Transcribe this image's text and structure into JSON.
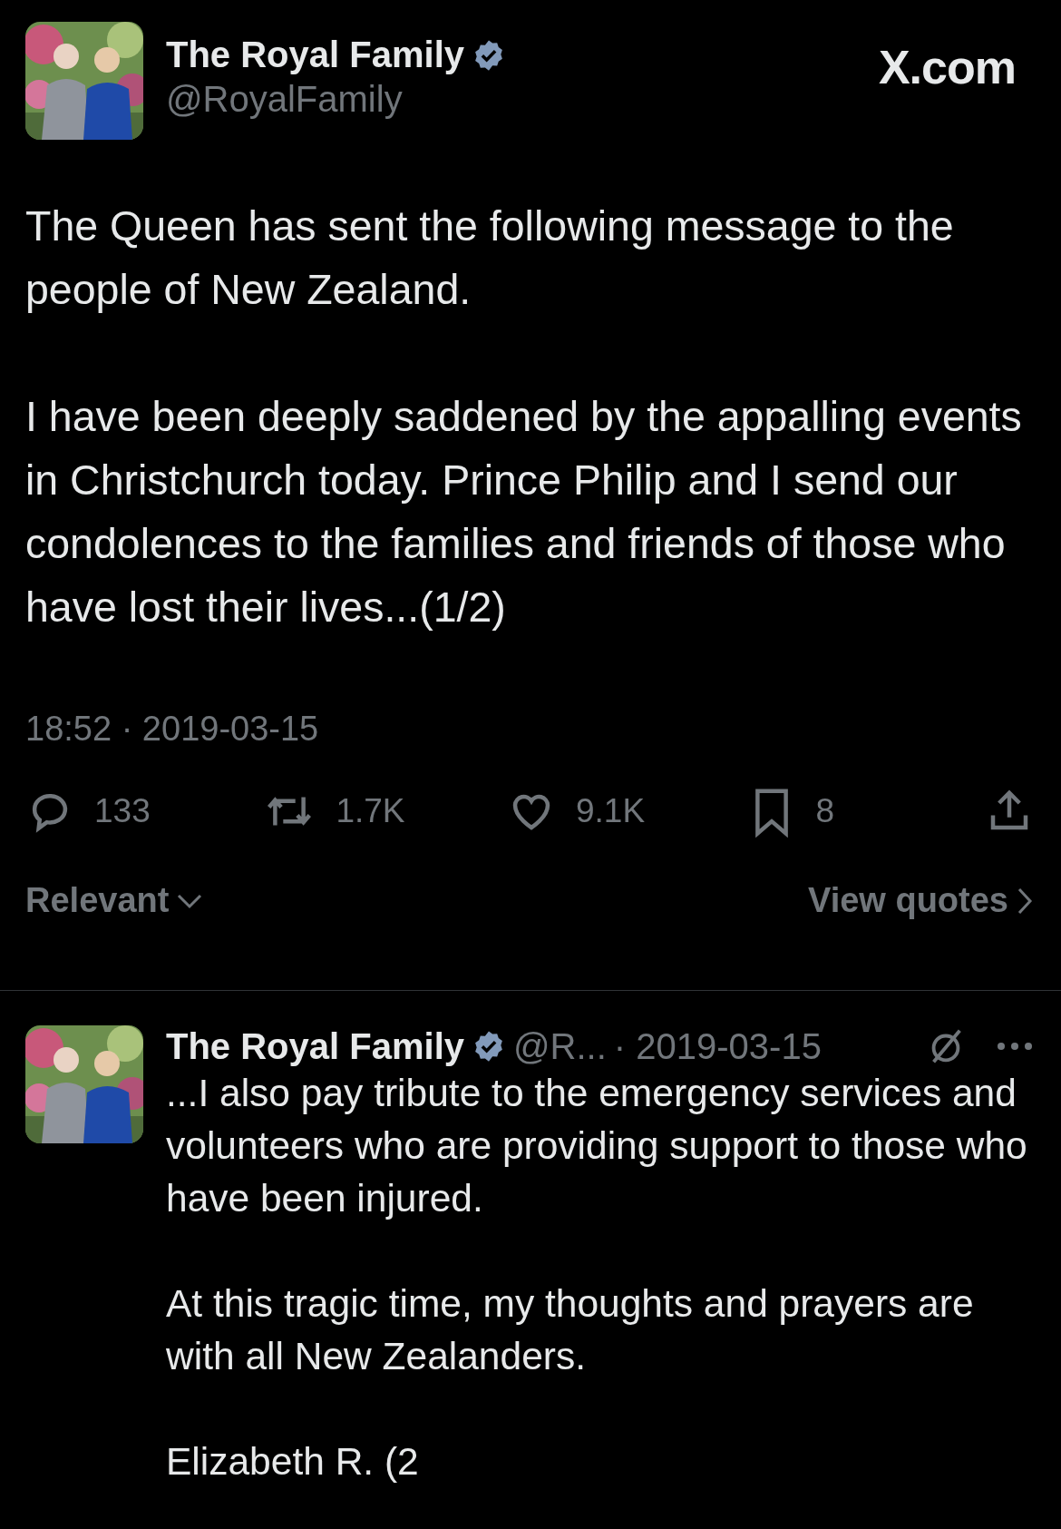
{
  "post": {
    "author": {
      "name": "The Royal Family",
      "handle": "@RoyalFamily",
      "verified": true
    },
    "site": "X.com",
    "paragraphs": [
      "The Queen has sent the following message to the people of New Zealand.",
      "I have been deeply saddened by the appalling events in Christchurch today. Prince Philip and I send our condolences to the families and friends of those who have lost their lives...(1/2)"
    ],
    "timestamp": "18:52 · 2019-03-15",
    "actions": [
      {
        "kind": "reply",
        "count": "133"
      },
      {
        "kind": "repost",
        "count": "1.7K"
      },
      {
        "kind": "like",
        "count": "9.1K"
      },
      {
        "kind": "bookmark",
        "count": "8"
      },
      {
        "kind": "share"
      }
    ],
    "sort": "Relevant",
    "quotes_link": "View quotes"
  },
  "replies": [
    {
      "author": {
        "name": "The Royal Family",
        "handle": "@R...",
        "verified": true
      },
      "date": "· 2019-03-15",
      "paragraphs": [
        "...I also pay tribute to the emergency services and volunteers who are providing support to those who have been injured.",
        "At this tragic time, my thoughts and prayers are with all New Zealanders.",
        "Elizabeth R. (2"
      ]
    }
  ]
}
